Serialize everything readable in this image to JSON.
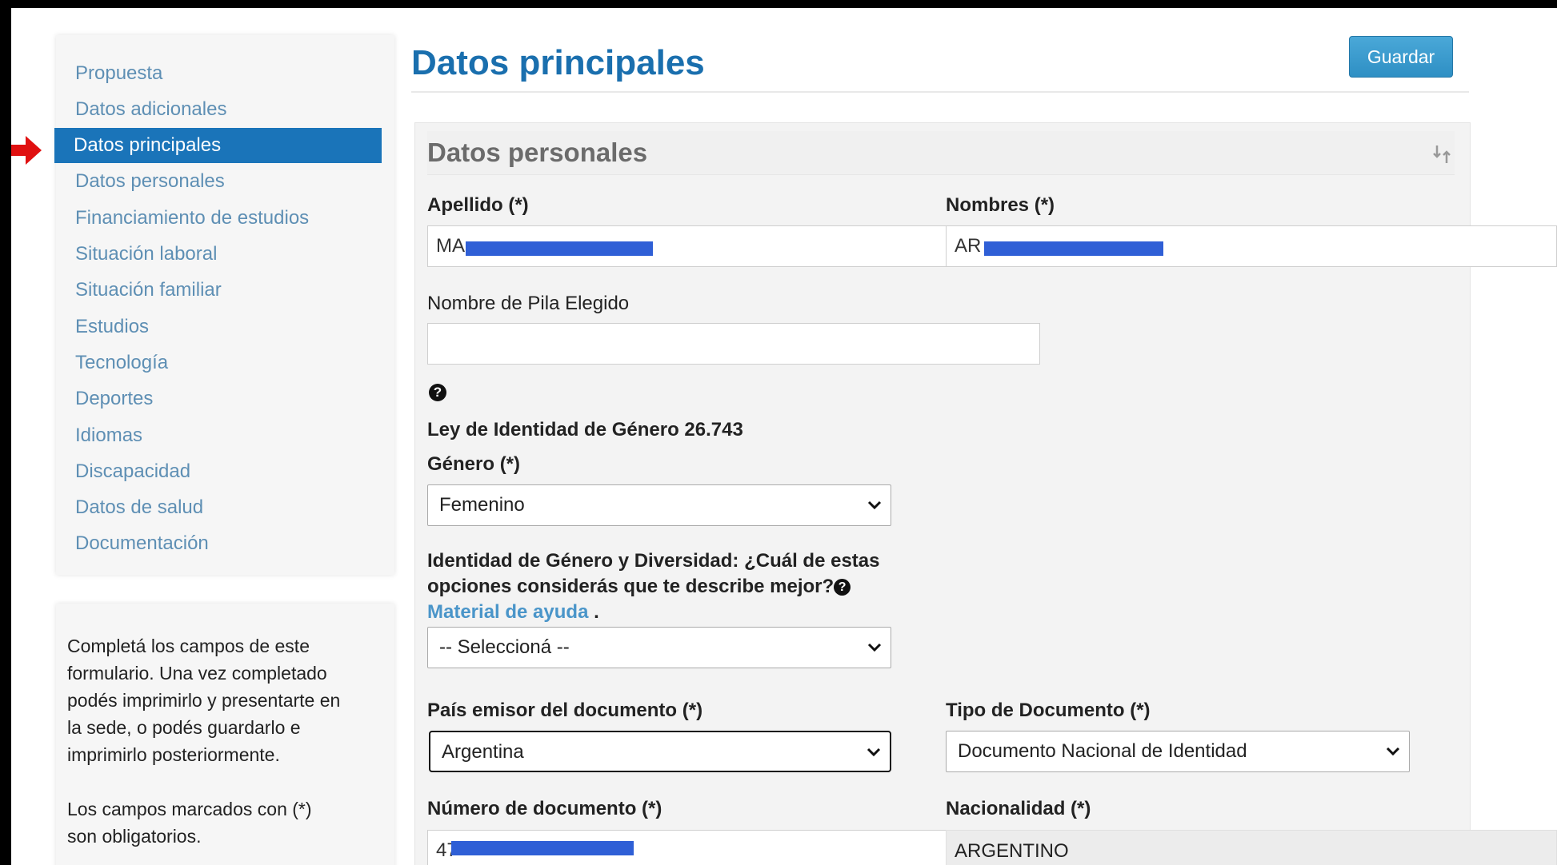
{
  "sidebar": {
    "items": [
      {
        "label": "Propuesta",
        "active": false
      },
      {
        "label": "Datos adicionales",
        "active": false
      },
      {
        "label": "Datos principales",
        "active": true
      },
      {
        "label": "Datos personales",
        "active": false
      },
      {
        "label": "Financiamiento de estudios",
        "active": false
      },
      {
        "label": "Situación laboral",
        "active": false
      },
      {
        "label": "Situación familiar",
        "active": false
      },
      {
        "label": "Estudios",
        "active": false
      },
      {
        "label": "Tecnología",
        "active": false
      },
      {
        "label": "Deportes",
        "active": false
      },
      {
        "label": "Idiomas",
        "active": false
      },
      {
        "label": "Discapacidad",
        "active": false
      },
      {
        "label": "Datos de salud",
        "active": false
      },
      {
        "label": "Documentación",
        "active": false
      }
    ],
    "help_paragraph_1": [
      "Completá los campos de este",
      "formulario. Una vez completado",
      "podés imprimirlo y presentarte en",
      "la sede, o podés guardarlo e",
      "imprimirlo posteriormente."
    ],
    "help_paragraph_2": [
      "Los campos marcados con (*)",
      "son obligatorios."
    ]
  },
  "header": {
    "title": "Datos principales",
    "save_label": "Guardar"
  },
  "section": {
    "title": "Datos personales"
  },
  "form": {
    "apellido_label": "Apellido (*)",
    "apellido_value": "MA",
    "nombres_label": "Nombres (*)",
    "nombres_value": "AR",
    "pila_label": "Nombre de Pila Elegido",
    "pila_value": "",
    "help_glyph": "?",
    "ley_label": "Ley de Identidad de Género 26.743",
    "genero_label": "Género (*)",
    "genero_value": "Femenino",
    "identidad_label_line1": "Identidad de Género y Diversidad: ¿Cuál de estas",
    "identidad_label_line2": "opciones considerás que te describe mejor?",
    "material_link": "Material de ayuda",
    "identidad_value": "-- Seleccioná --",
    "pais_label": "País emisor del documento (*)",
    "pais_value": "Argentina",
    "tipo_label": "Tipo de Documento (*)",
    "tipo_value": "Documento Nacional de Identidad",
    "numero_label": "Número de documento (*)",
    "numero_value": "47",
    "nacionalidad_label": "Nacionalidad (*)",
    "nacionalidad_value": "ARGENTINO"
  },
  "colors": {
    "accent": "#1a74b9",
    "link": "#5e8fb4",
    "title": "#1a6fae",
    "redaction": "#2f5fd6",
    "pointer_arrow": "#e01010"
  }
}
